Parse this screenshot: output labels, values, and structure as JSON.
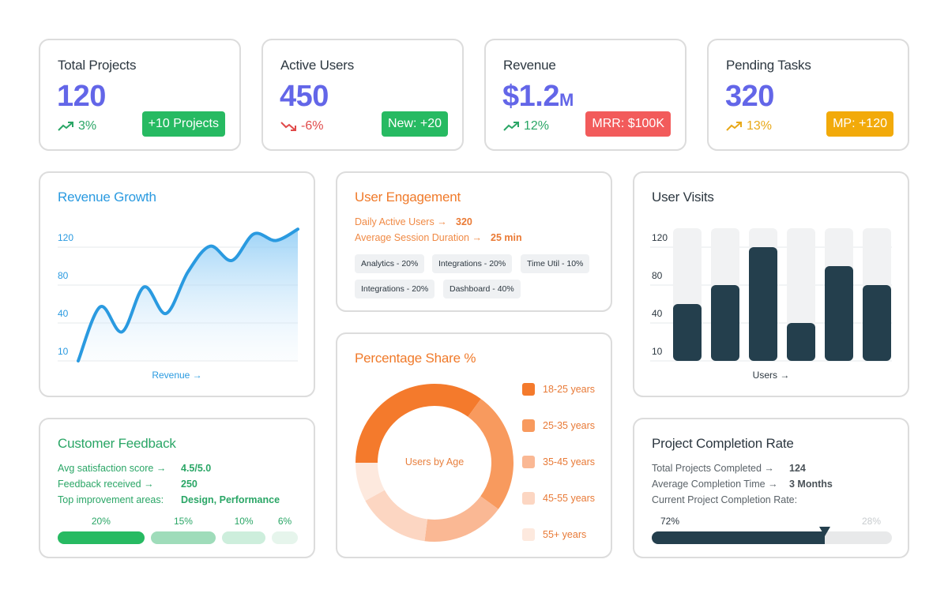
{
  "colors": {
    "indigo": "#6366e8",
    "green": "#27ba62",
    "red": "#f25b5b",
    "amber": "#f2aa0a",
    "blue": "#2a9ae0",
    "orange": "#f07a2a",
    "dark": "#243f4d"
  },
  "stats": [
    {
      "title": "Total Projects",
      "value": "120",
      "unit": "",
      "trend": "3%",
      "trend_dir": "up",
      "trend_color": "#2aa666",
      "badge": "+10 Projects",
      "badge_color": "#27ba62"
    },
    {
      "title": "Active Users",
      "value": "450",
      "unit": "",
      "trend": "-6%",
      "trend_dir": "down",
      "trend_color": "#e04a4a",
      "badge": "New: +20",
      "badge_color": "#27ba62"
    },
    {
      "title": "Revenue",
      "value": "$1.2",
      "unit": "M",
      "trend": "12%",
      "trend_dir": "up",
      "trend_color": "#2aa666",
      "badge": "MRR: $100K",
      "badge_color": "#f25b5b"
    },
    {
      "title": "Pending Tasks",
      "value": "320",
      "unit": "",
      "trend": "13%",
      "trend_dir": "up",
      "trend_color": "#e8a818",
      "badge": "MP: +120",
      "badge_color": "#f2aa0a"
    }
  ],
  "revenue_growth": {
    "title": "Revenue Growth",
    "caption": "Revenue →"
  },
  "user_engagement": {
    "title": "User Engagement",
    "rows": [
      {
        "label": "Daily Active Users →",
        "value": "320"
      },
      {
        "label": "Average Session Duration →",
        "value": "25 min"
      }
    ],
    "chips": [
      "Analytics - 20%",
      "Integrations - 20%",
      "Time Util - 10%",
      "Integrations - 20%",
      "Dashboard - 40%"
    ]
  },
  "user_visits": {
    "title": "User Visits",
    "caption": "Users →"
  },
  "percentage_share": {
    "title": "Percentage Share %",
    "center_label": "Users by Age"
  },
  "customer_feedback": {
    "title": "Customer Feedback",
    "rows": [
      {
        "label": "Avg satisfaction score →",
        "value": "4.5/5.0"
      },
      {
        "label": "Feedback received →",
        "value": "250"
      },
      {
        "label": "Top improvement areas:",
        "value": "Design, Performance"
      }
    ],
    "bars": [
      {
        "label": "20%",
        "value": 20,
        "color": "#27ba62"
      },
      {
        "label": "15%",
        "value": 15,
        "color": "#9fdcba"
      },
      {
        "label": "10%",
        "value": 10,
        "color": "#cdeedc"
      },
      {
        "label": "6%",
        "value": 6,
        "color": "#e6f5ec"
      }
    ]
  },
  "project_completion": {
    "title": "Project Completion Rate",
    "rows": [
      {
        "label": "Total Projects Completed →",
        "value": "124"
      },
      {
        "label": "Average Completion Time →",
        "value": "3 Months"
      },
      {
        "label": "Current Project Completion Rate:",
        "value": ""
      }
    ],
    "completed_label": "72%",
    "remaining_label": "28%",
    "completed_percent": 72
  },
  "chart_data": [
    {
      "type": "area",
      "title": "Revenue Growth",
      "xlabel": "Revenue →",
      "ylabel": "",
      "ytick_labels": [
        "10",
        "40",
        "80",
        "120"
      ],
      "ytick_values": [
        10,
        40,
        80,
        120
      ],
      "grid": true,
      "x": [
        0,
        1,
        2,
        3,
        4,
        5,
        6,
        7,
        8,
        9,
        10
      ],
      "values": [
        10,
        57,
        33,
        78,
        50,
        94,
        121,
        106,
        134,
        127,
        139
      ],
      "color": "#2a9ae0"
    },
    {
      "type": "bar",
      "title": "User Visits",
      "xlabel": "Users →",
      "ylabel": "",
      "ytick_labels": [
        "10",
        "40",
        "80",
        "120"
      ],
      "ytick_values": [
        10,
        40,
        80,
        120
      ],
      "grid": true,
      "categories": [
        "",
        "",
        "",
        "",
        "",
        ""
      ],
      "values": [
        60,
        80,
        120,
        40,
        100,
        80
      ],
      "track_max": 140,
      "color": "#243f4d"
    },
    {
      "type": "pie",
      "title": "Percentage Share %",
      "center_label": "Users by Age",
      "legend_position": "right",
      "categories": [
        "18-25 years",
        "25-35 years",
        "35-45 years",
        "45-55 years",
        "55+ years"
      ],
      "values": [
        35,
        25,
        17,
        15,
        8
      ],
      "colors": [
        "#f47a2c",
        "#f89a5e",
        "#fab894",
        "#fcd6c2",
        "#fde9de"
      ]
    }
  ]
}
